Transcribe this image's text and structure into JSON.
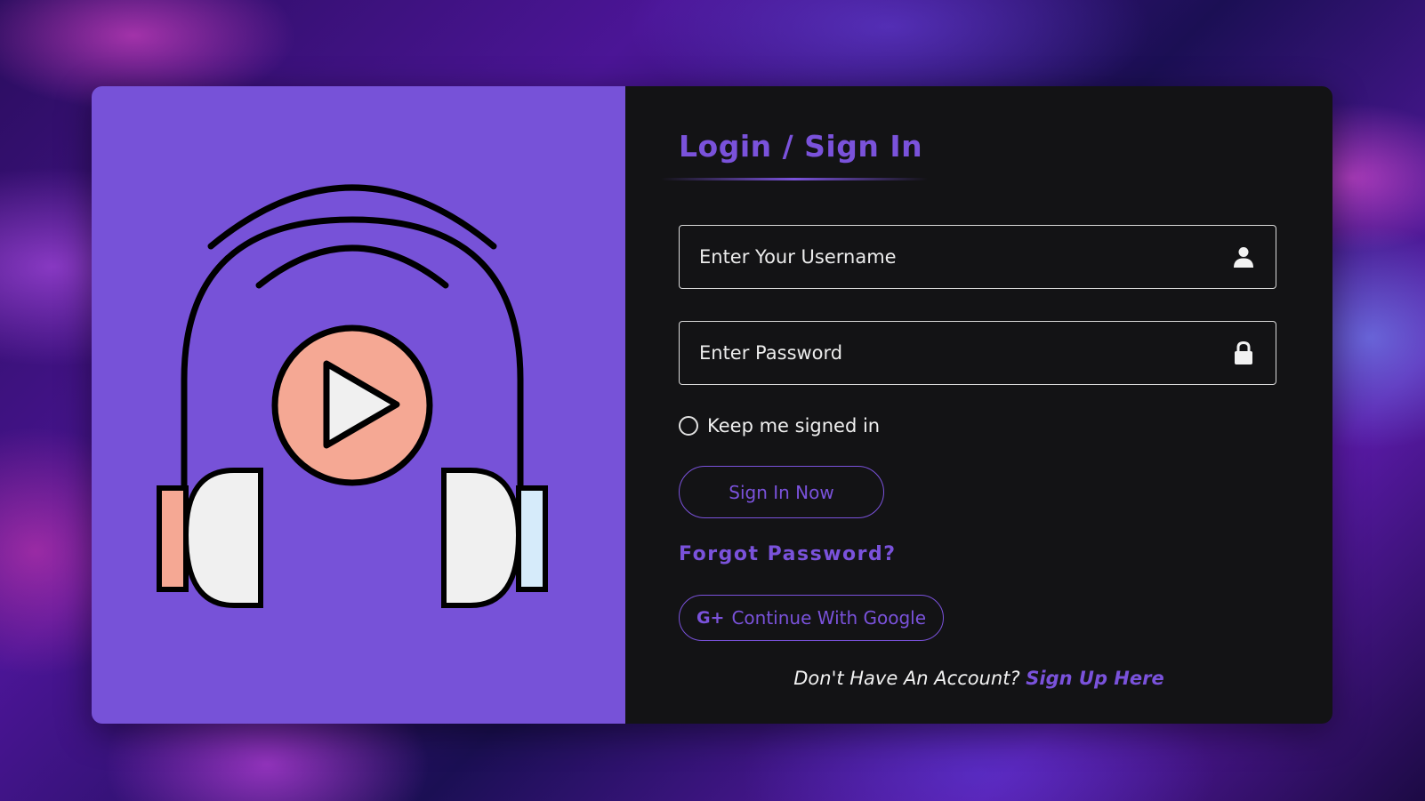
{
  "login": {
    "title": "Login / Sign In",
    "username_placeholder": "Enter Your Username",
    "password_placeholder": "Enter Password",
    "remember_label": "Keep me signed in",
    "signin_label": "Sign In Now",
    "forgot_label": "Forgot Password?",
    "google_icon_text": "G+",
    "google_label": "Continue With Google",
    "no_account_text": "Don't Have An Account?",
    "signup_label": "Sign Up Here"
  },
  "icons": {
    "username": "user-icon",
    "password": "lock-icon",
    "google": "google-plus-icon",
    "illustration": "headphones-play-icon"
  },
  "colors": {
    "accent": "#7a52db",
    "left_panel": "#7752d8",
    "right_panel": "#131315",
    "play_circle": "#f5a894",
    "earcup_right_accent": "#d6ebfa"
  }
}
